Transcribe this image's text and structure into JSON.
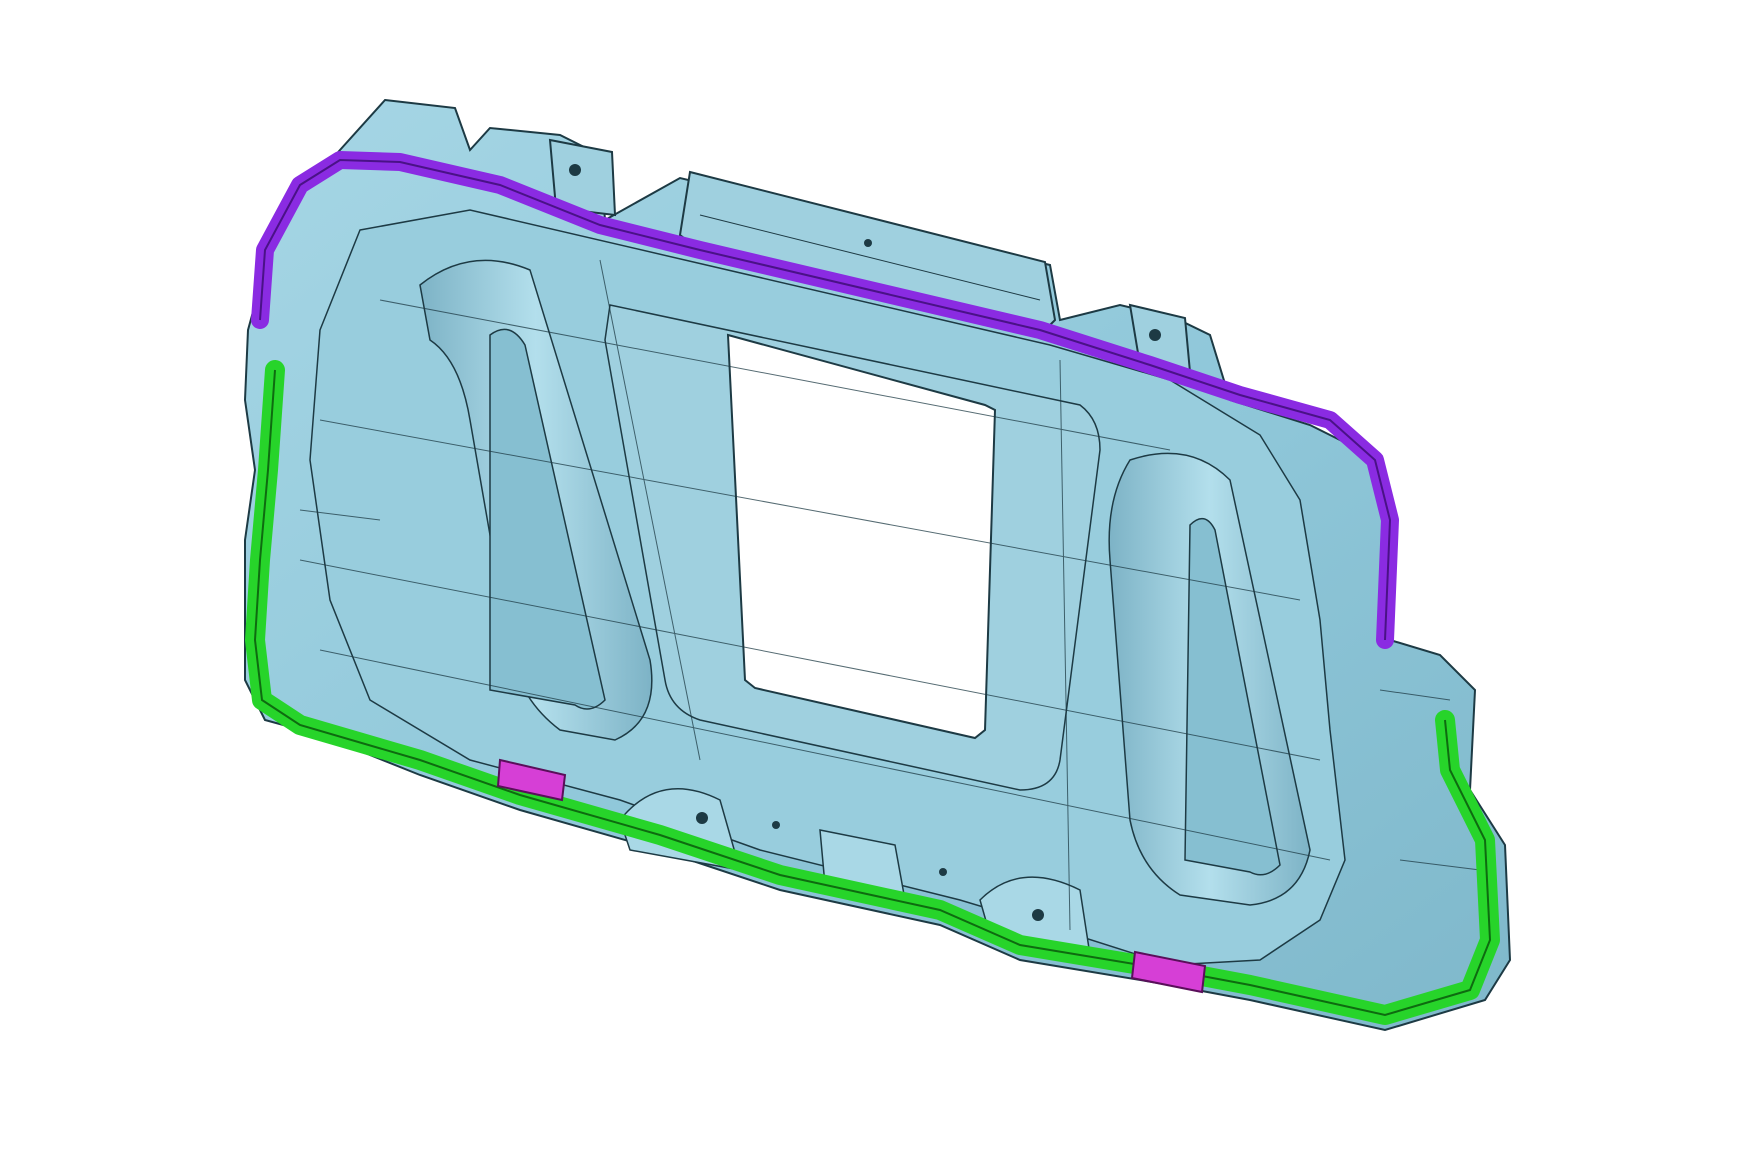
{
  "colors": {
    "background": "#ffffff",
    "body_fill": "#8fc7d9",
    "body_shade": "#7db3c6",
    "highlight": "#a9d8e6",
    "edge_line": "#1d3a44",
    "purple_rail": "#8a2be2",
    "purple_rail_dark": "#6a1fb3",
    "green_rail": "#27d42a",
    "green_rail_dark": "#169a18",
    "magenta_tab": "#d63fd6",
    "cutout": "#ffffff"
  },
  "parts": {
    "panel": {
      "name": "underbody-shield-panel"
    },
    "rail_top": {
      "name": "upper-reinforcement-rail",
      "color_key": "purple_rail"
    },
    "rail_bottom": {
      "name": "lower-reinforcement-rail",
      "color_key": "green_rail"
    },
    "tabs": [
      {
        "name": "clip-tab-left",
        "color_key": "magenta_tab"
      },
      {
        "name": "clip-tab-right",
        "color_key": "magenta_tab"
      }
    ],
    "cutout": {
      "name": "center-opening"
    }
  }
}
